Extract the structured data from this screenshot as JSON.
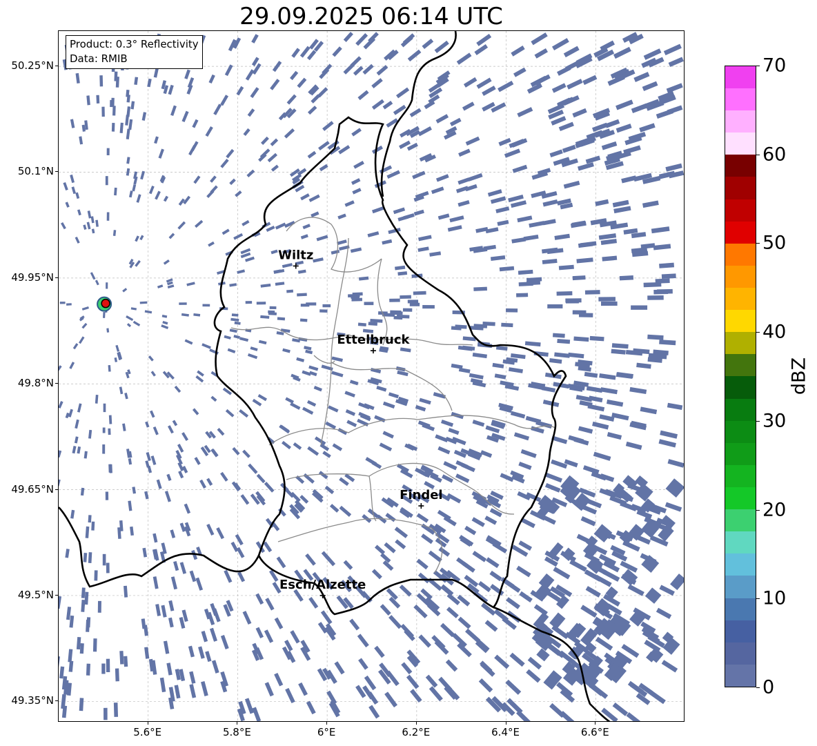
{
  "title": "29.09.2025 06:14 UTC",
  "info": {
    "product": "Product: 0.3° Reflectivity",
    "data": "Data: RMIB"
  },
  "map": {
    "lon_range": [
      5.4,
      6.8
    ],
    "lat_range": [
      49.32,
      50.3
    ],
    "lat_ticks": [
      {
        "value": 50.25,
        "label": "50.25°N"
      },
      {
        "value": 50.1,
        "label": "50.1°N"
      },
      {
        "value": 49.95,
        "label": "49.95°N"
      },
      {
        "value": 49.8,
        "label": "49.8°N"
      },
      {
        "value": 49.65,
        "label": "49.65°N"
      },
      {
        "value": 49.5,
        "label": "49.5°N"
      },
      {
        "value": 49.35,
        "label": "49.35°N"
      }
    ],
    "lon_ticks": [
      {
        "value": 5.6,
        "label": "5.6°E"
      },
      {
        "value": 5.8,
        "label": "5.8°E"
      },
      {
        "value": 6.0,
        "label": "6°E"
      },
      {
        "value": 6.2,
        "label": "6.2°E"
      },
      {
        "value": 6.4,
        "label": "6.4°E"
      },
      {
        "value": 6.6,
        "label": "6.6°E"
      }
    ],
    "cities": [
      {
        "name": "Wiltz",
        "lon": 5.93,
        "lat": 49.967
      },
      {
        "name": "Ettelbruck",
        "lon": 6.103,
        "lat": 49.847
      },
      {
        "name": "Findel",
        "lon": 6.21,
        "lat": 49.627
      },
      {
        "name": "Esch/Alzette",
        "lon": 5.99,
        "lat": 49.5
      }
    ],
    "radar_site": {
      "lon": 5.505,
      "lat": 49.914
    },
    "echo_color": "#6274a6"
  },
  "colorbar": {
    "unit": "dBZ",
    "min": 0,
    "max": 70,
    "ticks": [
      {
        "value": 0,
        "label": "0"
      },
      {
        "value": 10,
        "label": "10"
      },
      {
        "value": 20,
        "label": "20"
      },
      {
        "value": 30,
        "label": "30"
      },
      {
        "value": 40,
        "label": "40"
      },
      {
        "value": 50,
        "label": "50"
      },
      {
        "value": 60,
        "label": "60"
      },
      {
        "value": 70,
        "label": "70"
      }
    ],
    "colors": [
      "#6474a8",
      "#5566a0",
      "#4660a2",
      "#4a78b0",
      "#5a9cc8",
      "#62c0dc",
      "#60d8c0",
      "#3cd070",
      "#14c828",
      "#14b420",
      "#109c18",
      "#0c8c14",
      "#087c10",
      "#065c0a",
      "#43750d",
      "#b0b000",
      "#ffd800",
      "#ffb400",
      "#ff9800",
      "#ff7800",
      "#e00000",
      "#c00000",
      "#a00000",
      "#780000",
      "#ffe0ff",
      "#ffb0ff",
      "#ff70ff",
      "#f040f0"
    ]
  }
}
